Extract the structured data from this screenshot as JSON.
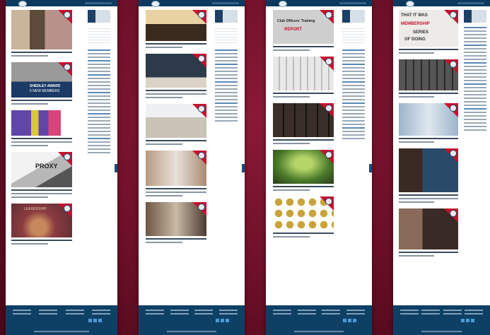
{
  "colors": {
    "backdrop": "#6b0f28",
    "footer": "#0e4066",
    "ribbon": "#c8102e",
    "header": "#0c3a5e"
  },
  "strips": [
    {
      "name": "page-1",
      "captions": [
        "SHEDLEY AWARD",
        "5 NEW MEMBERS",
        "PROXY",
        "LEADERSHIP"
      ]
    },
    {
      "name": "page-2",
      "captions": []
    },
    {
      "name": "page-3",
      "captions": [
        "Club Officers' Training",
        "REPORT"
      ]
    },
    {
      "name": "page-4",
      "captions": [
        "MEMBERSHIP",
        "THAT IT WAS",
        "SERIES",
        "OF DOING"
      ]
    }
  ]
}
